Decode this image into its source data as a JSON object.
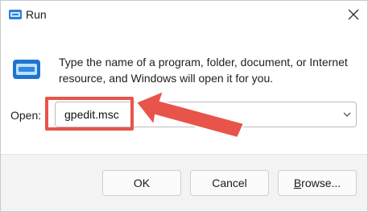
{
  "window": {
    "title": "Run",
    "app_icon": "run-app-icon",
    "close_icon": "close-icon"
  },
  "body": {
    "description": "Type the name of a program, folder, document, or Internet resource, and Windows will open it for you.",
    "open_label": "Open:",
    "open_value": "gpedit.msc",
    "run_icon": "run-program-icon"
  },
  "buttons": {
    "ok": "OK",
    "cancel": "Cancel",
    "browse": "Browse..."
  },
  "annotation": {
    "highlight_color": "#e8544a"
  }
}
